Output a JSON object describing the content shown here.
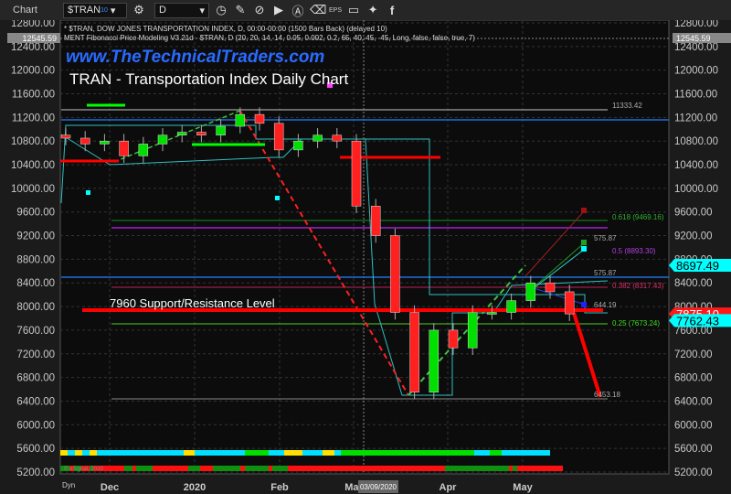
{
  "toolbar": {
    "app_label": "Chart",
    "symbol": "$TRAN",
    "symbol_badge": "10",
    "interval": "D",
    "icons": [
      "link-icon",
      "symbol-settings-icon",
      "interval-clock-icon",
      "pencil-icon",
      "indicator-icon",
      "play-icon",
      "alert-icon",
      "eraser-icon",
      "eps-icon",
      "comment-icon",
      "twitter-icon",
      "facebook-icon"
    ],
    "eps_label": "EPS"
  },
  "header": {
    "line1": "* $TRAN, DOW JONES TRANSPORTATION INDEX, D, 00:00-00:00 (1500 Bars Back) (delayed 10)",
    "line2": "MENT Fibonacci Price Modeling V3.21d - $TRAN, D (20, 20, 14, 14, 0.05, 0.002, 0.2, 65, 40, 45, -45, Long, false, false, true, 7)"
  },
  "watermark": "www.TheTechnicalTraders.com",
  "title": "TRAN - Transportation Index Daily Chart",
  "annotation": "7960 Support/Resistance Level",
  "copyright": "© eSignal, 2020",
  "dyn_label": "Dyn",
  "crosshair_date": "03/09/2020",
  "crosshair_price": "12545.59",
  "levels": {
    "top": "11333.42",
    "bottom": "6453.18",
    "d1": "575.87",
    "d2": "575.87",
    "d3": "644.19",
    "f618": "0.618 (9469.16)",
    "f5": "0.5 (8893.30)",
    "f382": "0.382 (8317.43)",
    "f25": "0.25 (7673.24)"
  },
  "price_tags": [
    {
      "label": "8697.49",
      "value": 8697.49,
      "color": "#00ffff"
    },
    {
      "label": "7875.10",
      "value": 7875.1,
      "color": "#ff1a1a"
    },
    {
      "label": "7762.43",
      "value": 7762.43,
      "color": "#00ffff"
    }
  ],
  "colors": {
    "up": "#00e000",
    "down": "#ff2020",
    "support": "#ff0000",
    "accent": "#00ffff"
  },
  "chart_data": {
    "type": "candlestick",
    "yticks": [
      "12800.00",
      "12400.00",
      "12000.00",
      "11600.00",
      "11200.00",
      "10800.00",
      "10400.00",
      "10000.00",
      "9600.00",
      "9200.00",
      "8800.00",
      "8400.00",
      "8000.00",
      "7600.00",
      "7200.00",
      "6800.00",
      "6400.00",
      "6000.00",
      "5600.00",
      "5200.00"
    ],
    "ylim": [
      5200,
      12800
    ],
    "xticks": [
      "Dec",
      "2020",
      "Feb",
      "Mar",
      "Apr",
      "May"
    ],
    "weeks": [
      "2019-11-15",
      "2019-11-22",
      "2019-11-29",
      "2019-12-06",
      "2019-12-13",
      "2019-12-20",
      "2019-12-27",
      "2020-01-03",
      "2020-01-10",
      "2020-01-17",
      "2020-01-24",
      "2020-01-31",
      "2020-02-07",
      "2020-02-14",
      "2020-02-21",
      "2020-02-28",
      "2020-03-06",
      "2020-03-13",
      "2020-03-20",
      "2020-03-27",
      "2020-04-03",
      "2020-04-10",
      "2020-04-17",
      "2020-04-24",
      "2020-05-01",
      "2020-05-08",
      "2020-05-15"
    ],
    "closes": [
      10850,
      10750,
      10800,
      10550,
      10750,
      10900,
      10950,
      10900,
      11050,
      11250,
      11100,
      10650,
      10800,
      10900,
      10800,
      9700,
      9200,
      7900,
      6550,
      7600,
      7300,
      7900,
      7900,
      8100,
      8400,
      8250,
      7875
    ]
  }
}
